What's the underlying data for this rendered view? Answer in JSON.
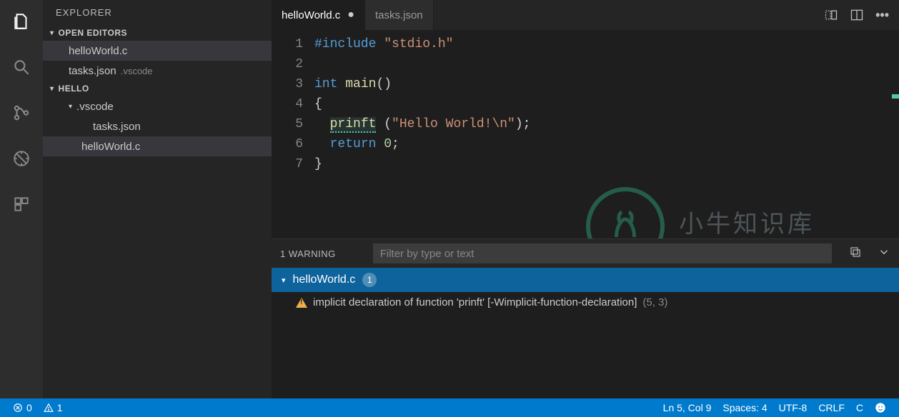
{
  "sidebar": {
    "title": "EXPLORER",
    "sections": {
      "openEditors": {
        "label": "OPEN EDITORS",
        "items": [
          {
            "name": "helloWorld.c",
            "folder": ""
          },
          {
            "name": "tasks.json",
            "folder": ".vscode"
          }
        ]
      },
      "workspace": {
        "label": "HELLO",
        "tree": [
          {
            "name": ".vscode",
            "type": "folder",
            "expanded": true,
            "children": [
              {
                "name": "tasks.json",
                "type": "file"
              }
            ]
          },
          {
            "name": "helloWorld.c",
            "type": "file",
            "selected": true
          }
        ]
      }
    }
  },
  "tabs": [
    {
      "name": "helloWorld.c",
      "active": true,
      "dirty": true
    },
    {
      "name": "tasks.json",
      "active": false,
      "dirty": false
    }
  ],
  "editor": {
    "lineCount": 7,
    "code": {
      "l1_include": "#include",
      "l1_str": "\"stdio.h\"",
      "l3_int": "int",
      "l3_main": "main",
      "l3_paren": "()",
      "l4_brace": "{",
      "l5_func": "prinft",
      "l5_paren_open": " (",
      "l5_str": "\"Hello World!\\n\"",
      "l5_end": ");",
      "l6_return": "return",
      "l6_zero": "0",
      "l6_semi": ";",
      "l7_brace": "}"
    }
  },
  "problems": {
    "summary": "1 WARNING",
    "filterPlaceholder": "Filter by type or text",
    "file": "helloWorld.c",
    "count": "1",
    "items": [
      {
        "severity": "warning",
        "message": "implicit declaration of function 'prinft' [-Wimplicit-function-declaration]",
        "location": "(5, 3)"
      }
    ]
  },
  "status": {
    "errors": "0",
    "warnings": "1",
    "lnCol": "Ln 5, Col 9",
    "spaces": "Spaces: 4",
    "encoding": "UTF-8",
    "eol": "CRLF",
    "lang": "C"
  },
  "watermark": {
    "text": "小牛知识库"
  }
}
